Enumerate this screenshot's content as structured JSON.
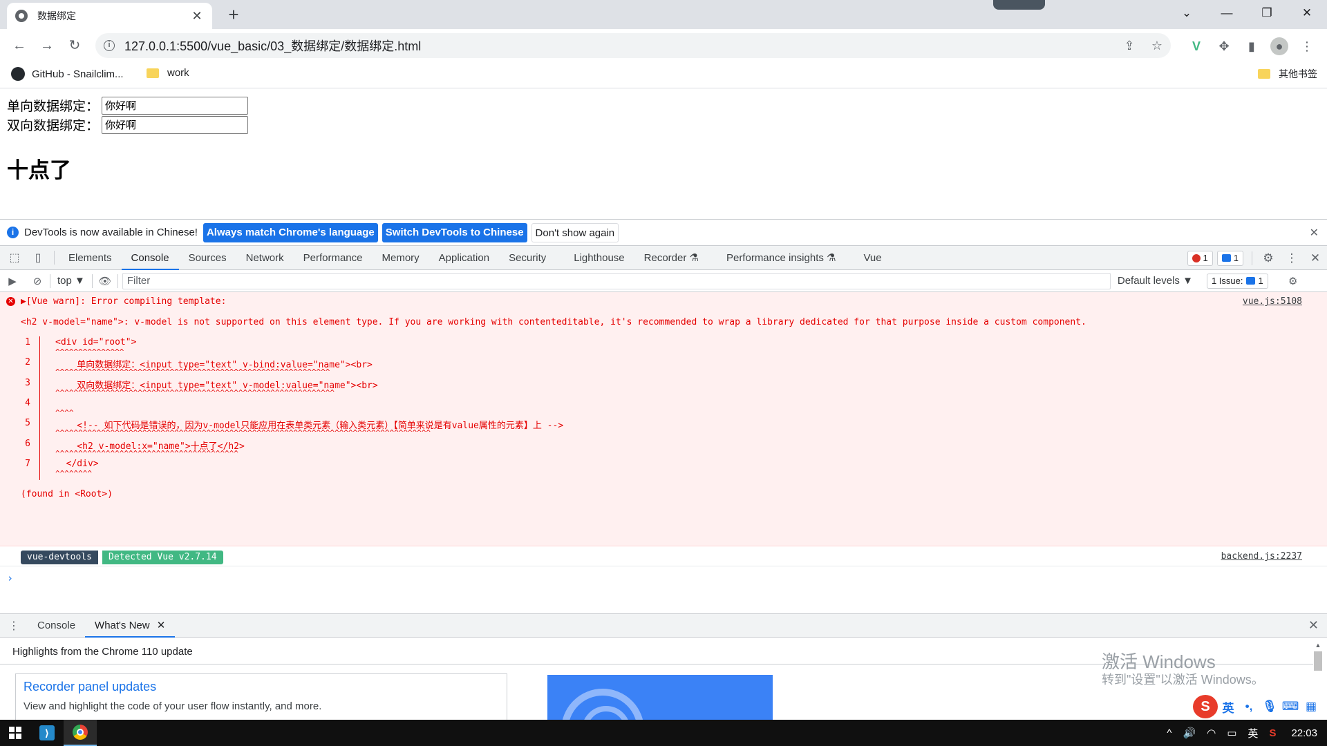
{
  "browser": {
    "tab_title": "数据绑定",
    "tab_close": "✕",
    "new_tab": "+",
    "url": "127.0.0.1:5500/vue_basic/03_数据绑定/数据绑定.html",
    "window": {
      "dropdown": "⌄",
      "minimize": "—",
      "restore": "❐",
      "close": "✕"
    }
  },
  "bookmarks": {
    "items": [
      {
        "label": "GitHub - Snailclim...",
        "icon": "github-icon"
      },
      {
        "label": "work",
        "icon": "folder-icon"
      }
    ],
    "other": "其他书签"
  },
  "page": {
    "one_way_label": "单向数据绑定：",
    "one_way_value": "你好啊",
    "two_way_label": "双向数据绑定：",
    "two_way_value": "你好啊",
    "heading": "十点了"
  },
  "devtools": {
    "infobar": {
      "message": "DevTools is now available in Chinese!",
      "btn_match": "Always match Chrome's language",
      "btn_switch": "Switch DevTools to Chinese",
      "btn_dismiss": "Don't show again"
    },
    "tabs": [
      "Elements",
      "Console",
      "Sources",
      "Network",
      "Performance",
      "Memory",
      "Application",
      "Security",
      "Lighthouse",
      "Recorder ⚗",
      "Performance insights ⚗",
      "Vue"
    ],
    "active_tab": "Console",
    "error_count": "1",
    "message_count": "1",
    "toolbar": {
      "context": "top ▼",
      "filter_placeholder": "Filter",
      "levels": "Default levels ▼",
      "issues_label": "1 Issue:",
      "issues_count": "1"
    },
    "console": {
      "error_title": "▶[Vue warn]: Error compiling template:",
      "error_source": "vue.js:5108",
      "error_detail": "<h2 v-model=\"name\">: v-model is not supported on this element type. If you are working with contenteditable, it's recommended to wrap a library dedicated for that purpose inside a custom component.",
      "code_lines": [
        {
          "num": "1",
          "code": "<div id=\"root\">",
          "carets": "^^^^^^^^^^^^^^^"
        },
        {
          "num": "2",
          "code": "    单向数据绑定：<input type=\"text\" v-bind:value=\"name\"><br>",
          "carets": "^^^^^^^^^^^^^^^^^^^^^^^^^^^^^^^^^^^^^^^^^^^^^^^^^^^^^^^^^^^^"
        },
        {
          "num": "3",
          "code": "    双向数据绑定：<input type=\"text\" v-model:value=\"name\"><br>",
          "carets": "^^^^^^^^^^^^^^^^^^^^^^^^^^^^^^^^^^^^^^^^^^^^^^^^^^^^^^^^^^^^^"
        },
        {
          "num": "4",
          "code": "",
          "carets": "^^^^"
        },
        {
          "num": "5",
          "code": "    <!-- 如下代码是错误的，因为v-model只能应用在表单类元素（输入类元素）【简单来说是有value属性的元素】上 -->",
          "carets": "^^^^^^^^^^^^^^^^^^^^^^^^^^^^^^^^^^^^^^^^^^^^^^^^^^^^^^^^^^^^^^^^^^^^^^^^^^^^^^^^^^"
        },
        {
          "num": "6",
          "code": "    <h2 v-model:x=\"name\">十点了</h2>",
          "carets": "^^^^^^^^^^^^^^^^^^^^^^^^^^^^^^^^^^^^^^^^"
        },
        {
          "num": "7",
          "code": "  </div>",
          "carets": "^^^^^^^^"
        }
      ],
      "found_in": "(found in <Root>)",
      "vue_badge_left": "vue-devtools",
      "vue_badge_right": "Detected Vue v2.7.14",
      "vue_source": "backend.js:2237",
      "prompt": "›"
    },
    "drawer": {
      "tabs": [
        "Console",
        "What's New"
      ],
      "active_tab": "What's New",
      "highlights": "Highlights from the Chrome 110 update",
      "card_title": "Recorder panel updates",
      "card_desc": "View and highlight the code of your user flow instantly, and more."
    }
  },
  "watermark": {
    "line1": "激活 Windows",
    "line2": "转到\"设置\"以激活 Windows。"
  },
  "ime": {
    "logo": "S",
    "lang": "英"
  },
  "taskbar": {
    "lang": "英",
    "time": "22:03"
  },
  "colors": {
    "accent": "#1a73e8",
    "error_text": "#e50000",
    "error_bg": "#fff0f0",
    "vue_dark": "#35495e",
    "vue_green": "#41b883"
  }
}
